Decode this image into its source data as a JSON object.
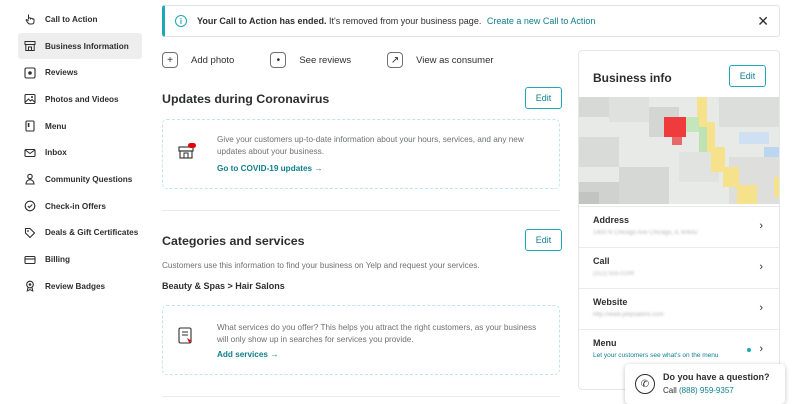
{
  "sidebar": {
    "items": [
      {
        "label": "Call to Action",
        "icon": "hand-pointer-icon",
        "active": false
      },
      {
        "label": "Business Information",
        "icon": "storefront-icon",
        "active": true
      },
      {
        "label": "Reviews",
        "icon": "star-box-icon",
        "active": false
      },
      {
        "label": "Photos and Videos",
        "icon": "image-icon",
        "active": false
      },
      {
        "label": "Menu",
        "icon": "menu-book-icon",
        "active": false
      },
      {
        "label": "Inbox",
        "icon": "envelope-icon",
        "active": false
      },
      {
        "label": "Community Questions",
        "icon": "people-icon",
        "active": false
      },
      {
        "label": "Check-in Offers",
        "icon": "check-badge-icon",
        "active": false
      },
      {
        "label": "Deals & Gift Certificates",
        "icon": "tag-icon",
        "active": false
      },
      {
        "label": "Billing",
        "icon": "credit-card-icon",
        "active": false
      },
      {
        "label": "Review Badges",
        "icon": "award-icon",
        "active": false
      }
    ]
  },
  "banner": {
    "bold": "Your Call to Action has ended.",
    "text": "It's removed from your business page.",
    "link": "Create a new Call to Action",
    "info_glyph": "i",
    "close_glyph": "✕"
  },
  "actions": [
    {
      "label": "Add photo",
      "icon": "add-photo-icon",
      "glyph": "+"
    },
    {
      "label": "See reviews",
      "icon": "see-reviews-icon",
      "glyph": "•"
    },
    {
      "label": "View as consumer",
      "icon": "external-link-icon",
      "glyph": "↗"
    }
  ],
  "covid": {
    "title": "Updates during Coronavirus",
    "edit": "Edit",
    "text": "Give your customers up-to-date information about your hours, services, and any new updates about your business.",
    "link": "Go to COVID-19 updates →"
  },
  "categories": {
    "title": "Categories and services",
    "edit": "Edit",
    "description": "Customers use this information to find your business on Yelp and request your services.",
    "category": "Beauty & Spas > Hair Salons",
    "services_text": "What services do you offer? This helps you attract the right customers, as your business will only show up in searches for services you provide.",
    "services_link": "Add services →"
  },
  "business_info": {
    "title": "Business info",
    "edit": "Edit",
    "rows": [
      {
        "label": "Address",
        "value": "1400 N Chicago Ave Chicago, IL 60642"
      },
      {
        "label": "Call",
        "value": "(312) 555-0199"
      },
      {
        "label": "Website",
        "value": "http://www.yelpsalons.com"
      },
      {
        "label": "Menu",
        "value": "Let your customers see what's on the menu"
      }
    ],
    "chevron": "›"
  },
  "question_widget": {
    "question": "Do you have a question?",
    "call_prefix": "Call",
    "phone": "(888) 959-9357",
    "glyph": "✆"
  },
  "colors": {
    "accent": "#1ba9b8",
    "link": "#0f7f8c",
    "text": "#2d2e2f",
    "muted": "#6e7072"
  }
}
